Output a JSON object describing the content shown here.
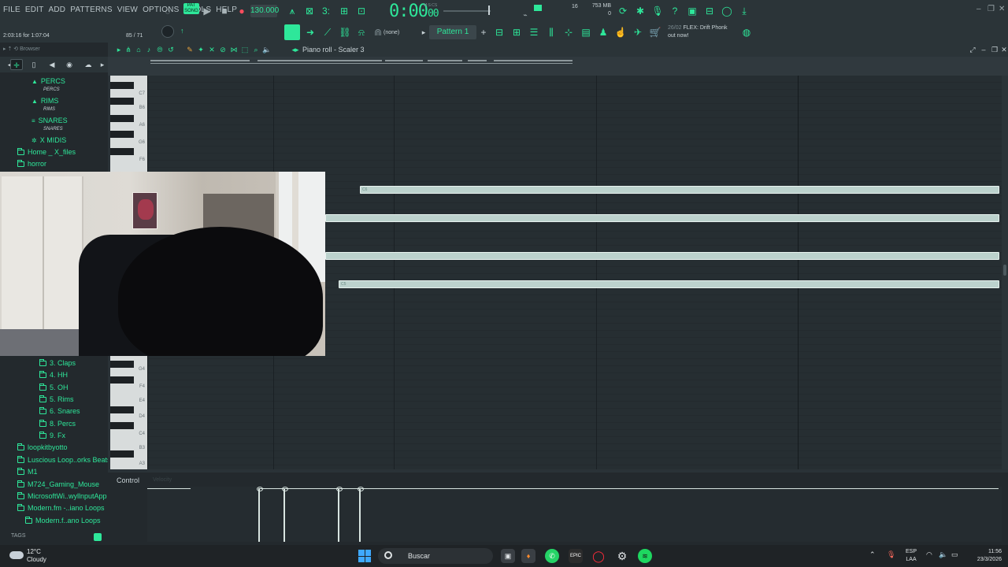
{
  "menu": [
    "FILE",
    "EDIT",
    "ADD",
    "PATTERNS",
    "VIEW",
    "OPTIONS",
    "TOOLS",
    "HELP"
  ],
  "transport": {
    "pat_badge": "PAT SONG",
    "tempo": "130.000",
    "time_main": "0:00",
    "time_sub": "00",
    "time_unit": "M:S:CS",
    "cpu_value": "16",
    "memory_mb": "753 MB",
    "memory_sub": "0"
  },
  "hint_bar": {
    "small": "",
    "text": "2:03:16 for 1:07:04",
    "count": "85 / 71"
  },
  "channel": {
    "snap": "(none)",
    "pattern": "Pattern 1"
  },
  "news": {
    "date": "26/02",
    "line1": "FLEX: Drift Phonk",
    "line2": "out now!"
  },
  "browser": {
    "title": "Browser",
    "items_top": [
      {
        "label": "PERCS",
        "sub": "PERCS",
        "icon": "▲"
      },
      {
        "label": "RIMS",
        "sub": "RIMS",
        "icon": "▲"
      },
      {
        "label": "SNARES",
        "sub": "SNARES",
        "icon": "≡"
      },
      {
        "label": "X MIDIS",
        "sub": "",
        "icon": "✲"
      }
    ],
    "folders_top": [
      "Home _ X_files",
      "horror"
    ],
    "folders_sub": [
      "3. Claps",
      "4. HH",
      "5. OH",
      "5. Rims",
      "6. Snares",
      "8. Percs",
      "9. Fx"
    ],
    "folders_bottom": [
      "loopkitbyotto",
      "Luscious Loop..orks Beats)",
      "M1",
      "M724_Gaming_Mouse",
      "MicrosoftWi..wyllnputApp",
      "Modern.fm -..iano Loops"
    ],
    "folder_last": "Modern.f..ano Loops",
    "tags": "TAGS"
  },
  "piano_roll": {
    "title": "Piano roll - Scaler 3",
    "key_labels_top": [
      "C7",
      "B6",
      "A6",
      "G6",
      "F6"
    ],
    "key_labels_bottom": [
      "G4",
      "F4",
      "E4",
      "D4",
      "C4",
      "B3",
      "A3"
    ],
    "note_labels": [
      "C6",
      "",
      "",
      "C5"
    ],
    "control_label": "Control",
    "control_sub": "Velocity"
  },
  "taskbar": {
    "temp": "12°C",
    "condition": "Cloudy",
    "search": "Buscar",
    "lang1": "ESP",
    "lang2": "LAA",
    "time": "11:56",
    "date": "23/3/2026"
  },
  "colors": {
    "accent": "#2ee79a",
    "note": "#bcd2cd",
    "background": "#262e33"
  }
}
